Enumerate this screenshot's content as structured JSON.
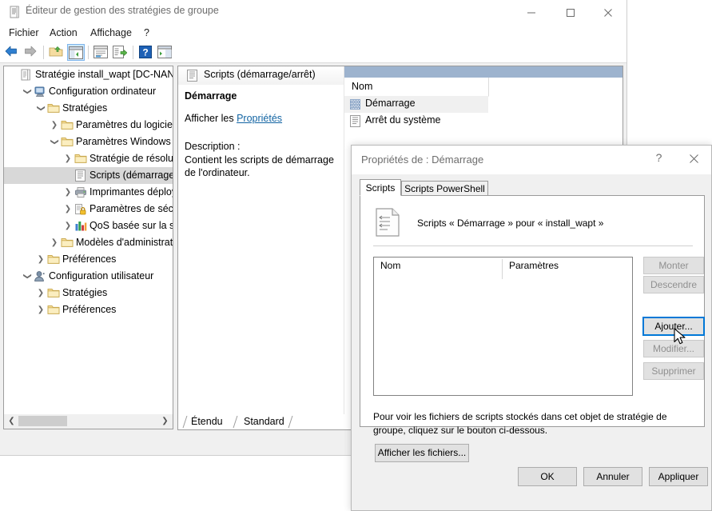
{
  "window": {
    "title": "Éditeur de gestion des stratégies de groupe",
    "icon": "policy-document-icon",
    "controls": {
      "minimize": "minimize-icon",
      "maximize": "maximize-icon",
      "close": "close-icon"
    }
  },
  "menubar": {
    "items": [
      {
        "label": "Fichier"
      },
      {
        "label": "Action"
      },
      {
        "label": "Affichage"
      },
      {
        "label": "?"
      }
    ]
  },
  "toolbar": {
    "buttons": [
      {
        "name": "back-icon",
        "selected": false
      },
      {
        "name": "forward-icon",
        "selected": false
      },
      {
        "name": "up-folder-icon",
        "selected": false
      },
      {
        "name": "show-hide-tree-icon",
        "selected": true
      },
      {
        "name": "properties-icon",
        "selected": false
      },
      {
        "name": "export-list-icon",
        "selected": false
      },
      {
        "name": "help-icon",
        "selected": false
      },
      {
        "name": "show-pane-icon",
        "selected": false
      }
    ]
  },
  "tree": {
    "items": [
      {
        "label": "Stratégie install_wapt [DC-NANTES.",
        "indent": 0,
        "chevron": "",
        "icon": "policy-document-icon",
        "selected": false
      },
      {
        "label": "Configuration ordinateur",
        "indent": 1,
        "chevron": "expanded",
        "icon": "computer-icon",
        "selected": false
      },
      {
        "label": "Stratégies",
        "indent": 2,
        "chevron": "expanded",
        "icon": "folder-icon",
        "selected": false
      },
      {
        "label": "Paramètres du logiciel",
        "indent": 3,
        "chevron": "collapsed",
        "icon": "folder-icon",
        "selected": false
      },
      {
        "label": "Paramètres Windows",
        "indent": 3,
        "chevron": "expanded",
        "icon": "folder-icon",
        "selected": false
      },
      {
        "label": "Stratégie de résolutio",
        "indent": 4,
        "chevron": "collapsed",
        "icon": "folder-icon",
        "selected": false
      },
      {
        "label": "Scripts (démarrage/ar",
        "indent": 4,
        "chevron": "",
        "icon": "scripts-icon",
        "selected": true
      },
      {
        "label": "Imprimantes déployé",
        "indent": 4,
        "chevron": "collapsed",
        "icon": "printer-icon",
        "selected": false
      },
      {
        "label": "Paramètres de sécurit",
        "indent": 4,
        "chevron": "collapsed",
        "icon": "security-lock-icon",
        "selected": false
      },
      {
        "label": "QoS basée sur la strat",
        "indent": 4,
        "chevron": "collapsed",
        "icon": "qos-chart-icon",
        "selected": false
      },
      {
        "label": "Modèles d'administration",
        "indent": 3,
        "chevron": "collapsed",
        "icon": "folder-icon",
        "selected": false
      },
      {
        "label": "Préférences",
        "indent": 2,
        "chevron": "collapsed",
        "icon": "folder-icon",
        "selected": false
      },
      {
        "label": "Configuration utilisateur",
        "indent": 1,
        "chevron": "expanded",
        "icon": "user-icon",
        "selected": false
      },
      {
        "label": "Stratégies",
        "indent": 2,
        "chevron": "collapsed",
        "icon": "folder-icon",
        "selected": false
      },
      {
        "label": "Préférences",
        "indent": 2,
        "chevron": "collapsed",
        "icon": "folder-icon",
        "selected": false
      }
    ]
  },
  "result_pane": {
    "header": {
      "title": "Scripts (démarrage/arrêt)",
      "icon": "scripts-icon"
    },
    "extended": {
      "title": "Démarrage",
      "show_prefix": "Afficher les ",
      "show_link": "Propriétés",
      "description_label": "Description :",
      "description_body": "Contient les scripts de démarrage de l'ordinateur."
    },
    "list": {
      "column_header": "Nom",
      "rows": [
        {
          "label": "Démarrage",
          "icon": "startup-script-icon",
          "selected": true
        },
        {
          "label": "Arrêt du système",
          "icon": "shutdown-script-icon",
          "selected": false
        }
      ]
    },
    "tabs": [
      {
        "label": "Étendu",
        "active": true
      },
      {
        "label": "Standard",
        "active": false
      }
    ]
  },
  "dialog": {
    "title": "Propriétés de : Démarrage",
    "help_glyph": "?",
    "close_icon": "close-icon",
    "tabs": [
      {
        "label": "Scripts",
        "active": true
      },
      {
        "label": "Scripts PowerShell",
        "active": false
      }
    ],
    "script_icon": "script-page-icon",
    "script_caption": "Scripts « Démarrage » pour « install_wapt »",
    "listbox": {
      "columns": [
        "Nom",
        "Paramètres"
      ],
      "rows": []
    },
    "side_buttons": [
      {
        "label": "Monter",
        "enabled": false
      },
      {
        "label": "Descendre",
        "enabled": false
      },
      {
        "label": "Ajouter...",
        "enabled": true
      },
      {
        "label": "Modifier...",
        "enabled": false
      },
      {
        "label": "Supprimer",
        "enabled": false
      }
    ],
    "note": "Pour voir les fichiers de scripts stockés dans cet objet de stratégie de groupe, cliquez sur le bouton ci-dessous.",
    "show_files_label": "Afficher les fichiers...",
    "bottom_buttons": {
      "ok": "OK",
      "cancel": "Annuler",
      "apply": "Appliquer"
    }
  },
  "colors": {
    "accent": "#0078d7",
    "link": "#1264a3",
    "list_header_band": "#9db3ce",
    "selection": "#d8d8d8"
  }
}
